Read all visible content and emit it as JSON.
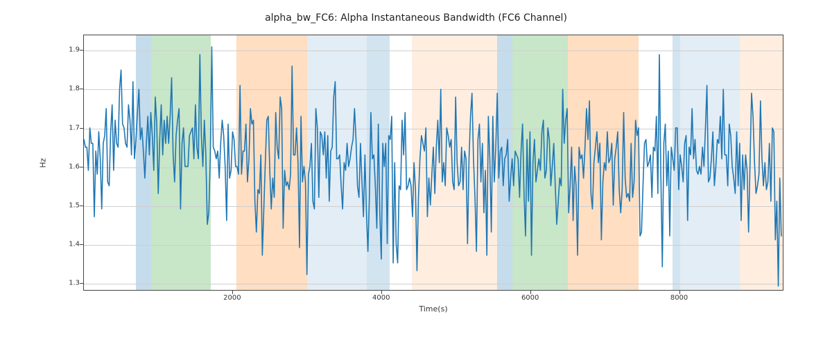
{
  "chart_data": {
    "type": "line",
    "title": "alpha_bw_FC6: Alpha Instantaneous Bandwidth (FC6 Channel)",
    "xlabel": "Time(s)",
    "ylabel": "Hz",
    "xlim": [
      0,
      9400
    ],
    "ylim": [
      1.28,
      1.94
    ],
    "xticks": [
      2000,
      4000,
      6000,
      8000
    ],
    "yticks": [
      1.3,
      1.4,
      1.5,
      1.6,
      1.7,
      1.8,
      1.9
    ],
    "x_step": 20,
    "regions": [
      {
        "start": 700,
        "end": 900,
        "color_idx": 0,
        "alpha": 0.26
      },
      {
        "start": 900,
        "end": 1700,
        "color_idx": 2,
        "alpha": 0.26
      },
      {
        "start": 2050,
        "end": 3000,
        "color_idx": 1,
        "alpha": 0.26
      },
      {
        "start": 3000,
        "end": 3800,
        "color_idx": 0,
        "alpha": 0.13
      },
      {
        "start": 3800,
        "end": 4100,
        "color_idx": 0,
        "alpha": 0.2
      },
      {
        "start": 4400,
        "end": 5550,
        "color_idx": 1,
        "alpha": 0.13
      },
      {
        "start": 5550,
        "end": 5750,
        "color_idx": 0,
        "alpha": 0.26
      },
      {
        "start": 5750,
        "end": 6500,
        "color_idx": 2,
        "alpha": 0.26
      },
      {
        "start": 6500,
        "end": 7450,
        "color_idx": 1,
        "alpha": 0.26
      },
      {
        "start": 7900,
        "end": 8000,
        "color_idx": 0,
        "alpha": 0.2
      },
      {
        "start": 8000,
        "end": 8800,
        "color_idx": 0,
        "alpha": 0.13
      },
      {
        "start": 8800,
        "end": 9400,
        "color_idx": 1,
        "alpha": 0.13
      }
    ],
    "region_colors": [
      "#1f77b4",
      "#ff7f0e",
      "#2ca02c"
    ],
    "series": [
      {
        "name": "alpha_bw_FC6",
        "values": [
          1.67,
          1.65,
          1.65,
          1.59,
          1.7,
          1.66,
          1.66,
          1.47,
          1.64,
          1.58,
          1.69,
          1.62,
          1.49,
          1.66,
          1.68,
          1.75,
          1.56,
          1.55,
          1.69,
          1.76,
          1.59,
          1.72,
          1.66,
          1.65,
          1.8,
          1.85,
          1.71,
          1.7,
          1.66,
          1.65,
          1.76,
          1.72,
          1.63,
          1.82,
          1.62,
          1.67,
          1.74,
          1.8,
          1.67,
          1.7,
          1.64,
          1.57,
          1.66,
          1.73,
          1.63,
          1.74,
          1.68,
          1.59,
          1.78,
          1.71,
          1.53,
          1.67,
          1.76,
          1.63,
          1.72,
          1.66,
          1.73,
          1.66,
          1.73,
          1.83,
          1.63,
          1.56,
          1.68,
          1.72,
          1.75,
          1.49,
          1.66,
          1.7,
          1.6,
          1.6,
          1.6,
          1.68,
          1.69,
          1.7,
          1.62,
          1.76,
          1.65,
          1.62,
          1.89,
          1.68,
          1.6,
          1.72,
          1.63,
          1.45,
          1.48,
          1.62,
          1.91,
          1.65,
          1.64,
          1.62,
          1.64,
          1.57,
          1.66,
          1.72,
          1.68,
          1.6,
          1.46,
          1.71,
          1.57,
          1.59,
          1.69,
          1.67,
          1.6,
          1.6,
          1.58,
          1.81,
          1.58,
          1.64,
          1.64,
          1.71,
          1.56,
          1.62,
          1.75,
          1.71,
          1.72,
          1.51,
          1.43,
          1.54,
          1.53,
          1.63,
          1.37,
          1.49,
          1.61,
          1.72,
          1.73,
          1.59,
          1.49,
          1.57,
          1.52,
          1.74,
          1.65,
          1.62,
          1.78,
          1.75,
          1.44,
          1.59,
          1.55,
          1.56,
          1.54,
          1.58,
          1.86,
          1.63,
          1.63,
          1.7,
          1.61,
          1.39,
          1.73,
          1.56,
          1.6,
          1.56,
          1.32,
          1.58,
          1.6,
          1.66,
          1.51,
          1.49,
          1.75,
          1.7,
          1.52,
          1.69,
          1.68,
          1.63,
          1.69,
          1.57,
          1.68,
          1.51,
          1.64,
          1.65,
          1.78,
          1.82,
          1.62,
          1.62,
          1.63,
          1.55,
          1.49,
          1.61,
          1.59,
          1.66,
          1.6,
          1.62,
          1.65,
          1.67,
          1.75,
          1.67,
          1.55,
          1.52,
          1.66,
          1.56,
          1.47,
          1.63,
          1.48,
          1.38,
          1.52,
          1.74,
          1.62,
          1.63,
          1.55,
          1.44,
          1.71,
          1.48,
          1.36,
          1.66,
          1.6,
          1.66,
          1.4,
          1.68,
          1.67,
          1.73,
          1.35,
          1.61,
          1.4,
          1.35,
          1.55,
          1.54,
          1.72,
          1.63,
          1.74,
          1.54,
          1.55,
          1.57,
          1.55,
          1.47,
          1.61,
          1.54,
          1.33,
          1.52,
          1.62,
          1.68,
          1.66,
          1.64,
          1.7,
          1.47,
          1.57,
          1.5,
          1.58,
          1.65,
          1.53,
          1.65,
          1.72,
          1.61,
          1.8,
          1.56,
          1.61,
          1.55,
          1.7,
          1.68,
          1.65,
          1.67,
          1.56,
          1.54,
          1.78,
          1.61,
          1.55,
          1.56,
          1.65,
          1.54,
          1.64,
          1.62,
          1.4,
          1.62,
          1.73,
          1.79,
          1.62,
          1.52,
          1.38,
          1.67,
          1.71,
          1.56,
          1.66,
          1.48,
          1.59,
          1.37,
          1.73,
          1.62,
          1.43,
          1.73,
          1.56,
          1.65,
          1.79,
          1.57,
          1.64,
          1.65,
          1.55,
          1.62,
          1.63,
          1.67,
          1.51,
          1.57,
          1.62,
          1.55,
          1.64,
          1.63,
          1.62,
          1.52,
          1.64,
          1.71,
          1.53,
          1.42,
          1.67,
          1.51,
          1.69,
          1.37,
          1.61,
          1.67,
          1.56,
          1.59,
          1.62,
          1.59,
          1.69,
          1.72,
          1.57,
          1.59,
          1.7,
          1.67,
          1.55,
          1.6,
          1.66,
          1.55,
          1.45,
          1.51,
          1.57,
          1.55,
          1.8,
          1.66,
          1.72,
          1.75,
          1.48,
          1.55,
          1.65,
          1.46,
          1.6,
          1.55,
          1.37,
          1.65,
          1.62,
          1.63,
          1.57,
          1.65,
          1.75,
          1.67,
          1.77,
          1.53,
          1.49,
          1.61,
          1.65,
          1.69,
          1.61,
          1.66,
          1.41,
          1.56,
          1.61,
          1.59,
          1.69,
          1.61,
          1.62,
          1.66,
          1.5,
          1.62,
          1.65,
          1.69,
          1.54,
          1.48,
          1.54,
          1.74,
          1.57,
          1.52,
          1.53,
          1.51,
          1.66,
          1.52,
          1.56,
          1.72,
          1.68,
          1.7,
          1.42,
          1.43,
          1.55,
          1.66,
          1.67,
          1.6,
          1.61,
          1.63,
          1.52,
          1.65,
          1.64,
          1.73,
          1.53,
          1.89,
          1.58,
          1.34,
          1.66,
          1.71,
          1.55,
          1.64,
          1.42,
          1.65,
          1.62,
          1.59,
          1.7,
          1.7,
          1.54,
          1.63,
          1.6,
          1.56,
          1.66,
          1.68,
          1.46,
          1.65,
          1.63,
          1.75,
          1.62,
          1.67,
          1.59,
          1.58,
          1.6,
          1.58,
          1.65,
          1.6,
          1.7,
          1.81,
          1.56,
          1.57,
          1.62,
          1.69,
          1.55,
          1.6,
          1.67,
          1.66,
          1.73,
          1.62,
          1.8,
          1.63,
          1.63,
          1.55,
          1.71,
          1.68,
          1.6,
          1.57,
          1.53,
          1.69,
          1.55,
          1.66,
          1.46,
          1.63,
          1.54,
          1.63,
          1.59,
          1.43,
          1.61,
          1.79,
          1.73,
          1.61,
          1.53,
          1.55,
          1.58,
          1.77,
          1.62,
          1.55,
          1.61,
          1.54,
          1.56,
          1.66,
          1.51,
          1.7,
          1.69,
          1.41,
          1.51,
          1.29,
          1.57,
          1.42
        ]
      }
    ]
  }
}
